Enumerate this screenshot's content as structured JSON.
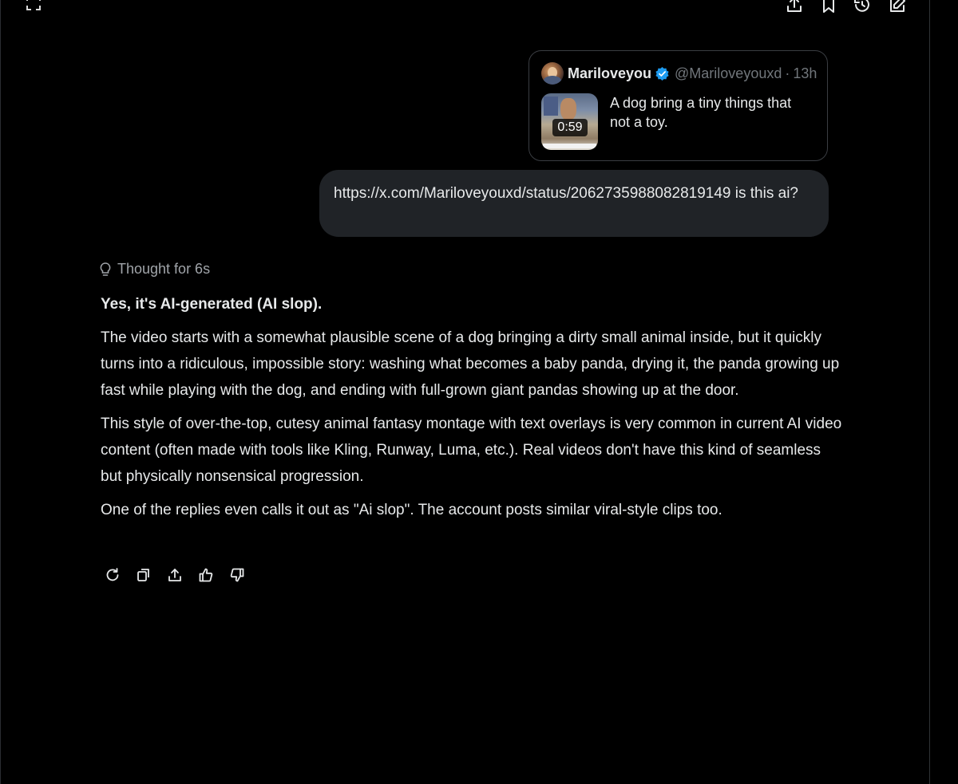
{
  "toolbar": {
    "left_icon": "expand-corners-icon",
    "right_icons": [
      "share-upload-icon",
      "bookmark-icon",
      "history-icon",
      "compose-edit-icon"
    ]
  },
  "quoted_post": {
    "display_name": "Mariloveyou",
    "verified": true,
    "handle": "@Mariloveyouxd",
    "separator": "·",
    "time": "13h",
    "video_duration": "0:59",
    "text": "A dog bring a tiny things that not a toy."
  },
  "user_message": {
    "text": "https://x.com/Mariloveyouxd/status/2062735988082819149 is this ai?"
  },
  "assistant": {
    "thought_label": "Thought for 6s",
    "headline": "Yes, it's AI-generated (AI slop).",
    "paragraphs": [
      "The video starts with a somewhat plausible scene of a dog bringing a dirty small animal inside, but it quickly turns into a ridiculous, impossible story: washing what becomes a baby panda, drying it, the panda growing up fast while playing with the dog, and ending with full-grown giant pandas showing up at the door.",
      "This style of over-the-top, cutesy animal fantasy montage with text overlays is very common in current AI video content (often made with tools like Kling, Runway, Luma, etc.). Real videos don't have this kind of seamless but physically nonsensical progression.",
      "One of the replies even calls it out as \"Ai slop\". The account posts similar viral-style clips too."
    ],
    "actions": [
      "regenerate-icon",
      "copy-icon",
      "share-icon",
      "thumbs-up-icon",
      "thumbs-down-icon"
    ]
  },
  "colors": {
    "background": "#000000",
    "text": "#e7e9ea",
    "muted": "#71767b",
    "bubble": "#202327",
    "verified": "#1d9bf0"
  }
}
